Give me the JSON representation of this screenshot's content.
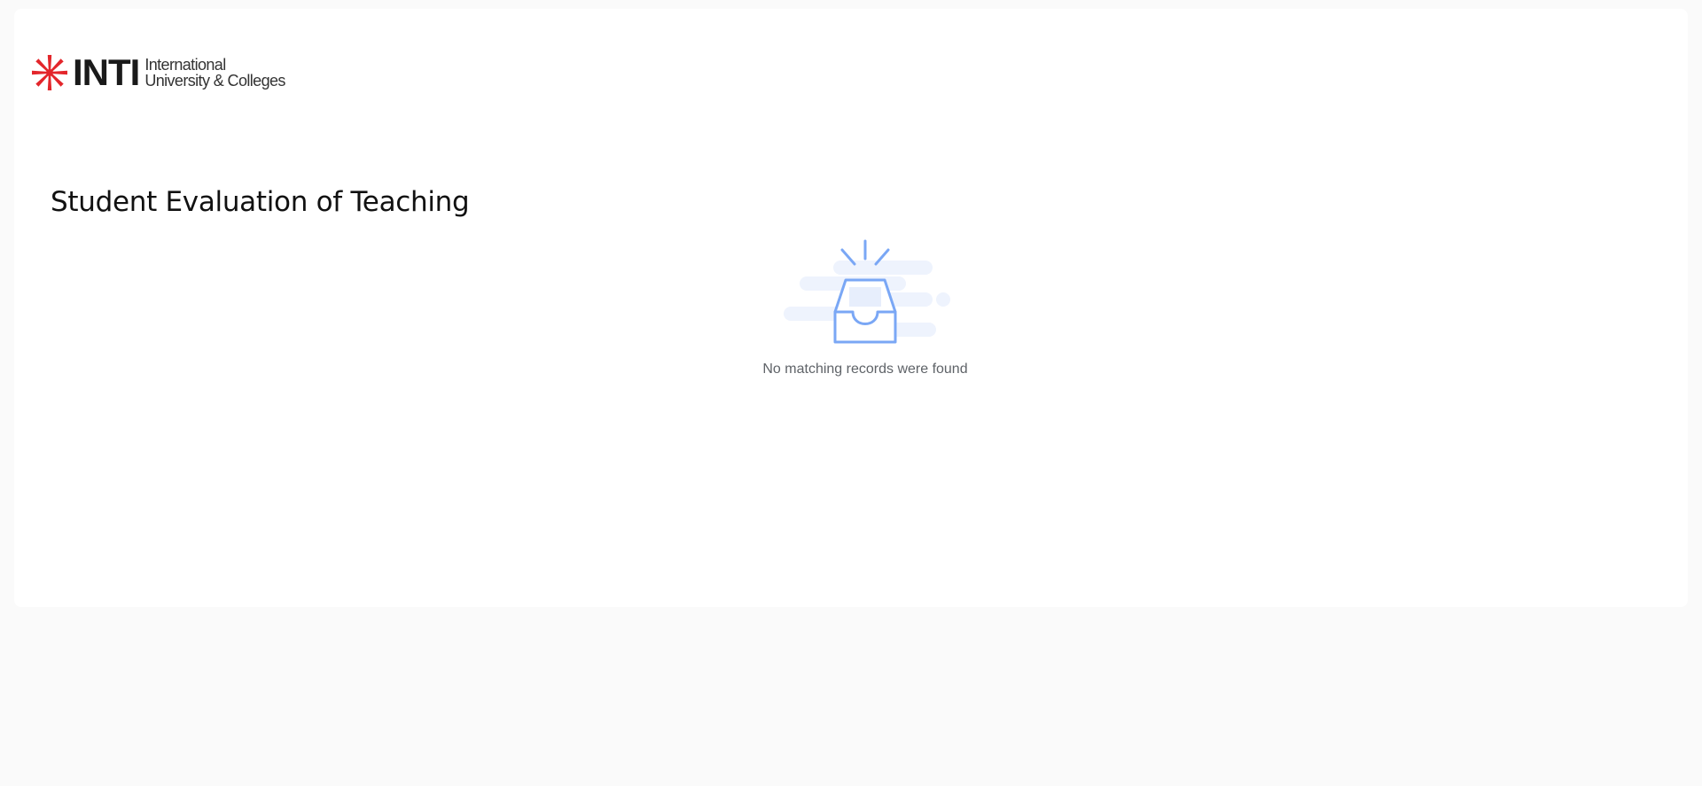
{
  "header": {
    "logo": {
      "wordmark": "INTI",
      "subtitle_line1": "International",
      "subtitle_line2": "University & Colleges",
      "brand_color": "#e3262b"
    }
  },
  "main": {
    "title": "Student Evaluation of Teaching",
    "empty_state": {
      "icon": "empty-inbox-icon",
      "message": "No matching records were found",
      "accent_color": "#7aa7f5"
    }
  }
}
